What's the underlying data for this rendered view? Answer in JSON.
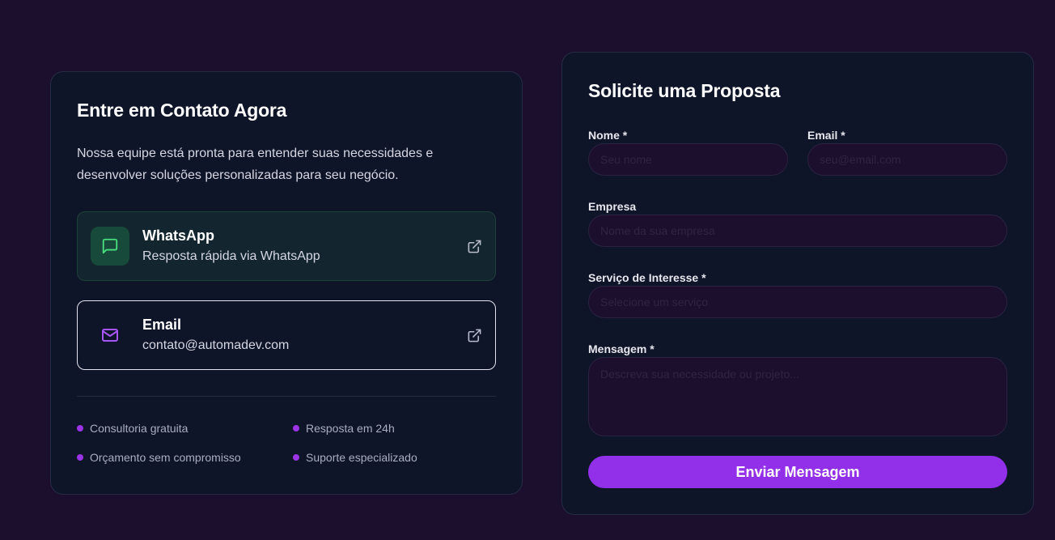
{
  "contact": {
    "title": "Entre em Contato Agora",
    "description": "Nossa equipe está pronta para entender suas necessidades e desenvolver soluções personalizadas para seu negócio.",
    "methods": [
      {
        "title": "WhatsApp",
        "subtitle": "Resposta rápida via WhatsApp",
        "icon": "message-square-icon",
        "accent": "#4ade80"
      },
      {
        "title": "Email",
        "subtitle": "contato@automadev.com",
        "icon": "mail-icon",
        "accent": "#a855f7"
      }
    ],
    "features": [
      "Consultoria gratuita",
      "Resposta em 24h",
      "Orçamento sem compromisso",
      "Suporte especializado"
    ]
  },
  "form": {
    "title": "Solicite uma Proposta",
    "fields": {
      "nome": {
        "label": "Nome *",
        "placeholder": "Seu nome"
      },
      "email": {
        "label": "Email *",
        "placeholder": "seu@email.com"
      },
      "empresa": {
        "label": "Empresa",
        "placeholder": "Nome da sua empresa"
      },
      "servico": {
        "label": "Serviço de Interesse *",
        "placeholder": "Selecione um serviço"
      },
      "mensagem": {
        "label": "Mensagem *",
        "placeholder": "Descreva sua necessidade ou projeto..."
      }
    },
    "submit_label": "Enviar Mensagem"
  },
  "colors": {
    "page_background": "#1b0f2d",
    "card_background": "#0f1529",
    "accent_purple": "#9130e8",
    "whatsapp_green": "#4ade80"
  }
}
